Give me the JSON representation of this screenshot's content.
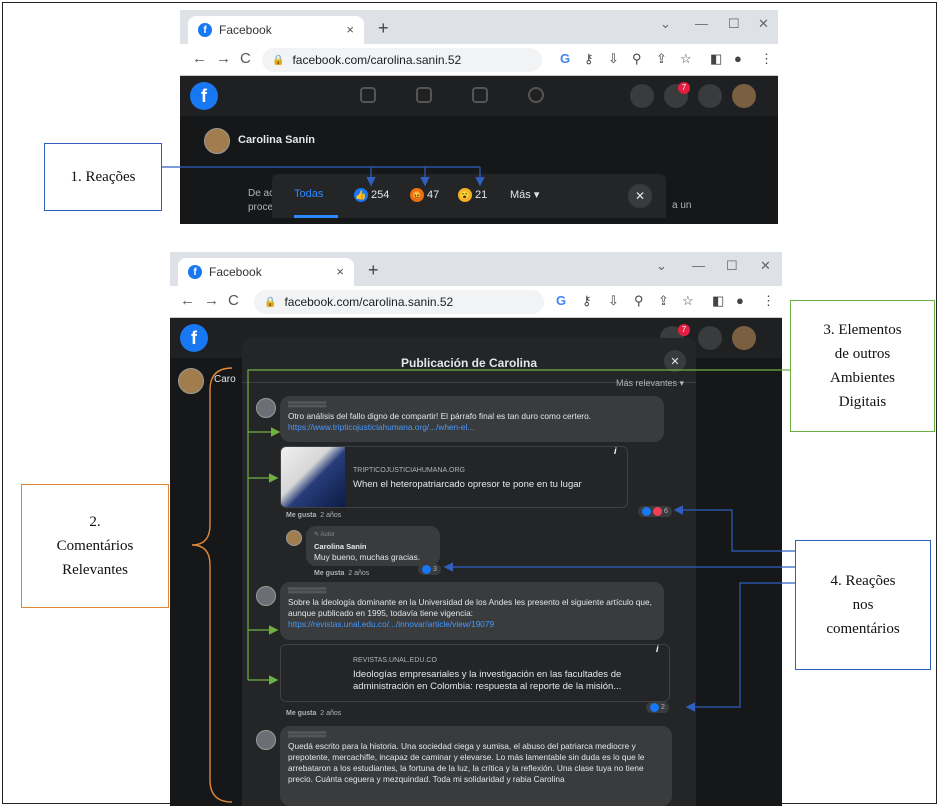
{
  "browser": {
    "tab_title": "Facebook",
    "url": "facebook.com/carolina.sanin.52",
    "new_tab_icon": "+",
    "close_icon": "×"
  },
  "screen1": {
    "profile_name": "Carolina Sanín",
    "snippet_left": "De acu",
    "snippet_left2": "proced",
    "snippet_right": "a un",
    "reactions_bar": {
      "all_label": "Todas",
      "like_count": "254",
      "angry_count": "47",
      "wow_count": "21",
      "more_label": "Más ▾"
    }
  },
  "screen2": {
    "modal_title": "Publicación de Carolina",
    "sort_label": "Más relevantes ▾",
    "side_name": "Caro",
    "comments": [
      {
        "text": "Otro análisis del fallo digno de compartir! El párrafo final es tan duro como certero.",
        "link": "https://www.tripticojusticiahumana.org/.../when-el...",
        "card_domain": "TRIPTICOJUSTICIAHUMANA.ORG",
        "card_title": "When el heteropatriarcado opresor te pone en tu lugar",
        "meta_like": "Me gusta",
        "meta_time": "2 años",
        "reaction_count": "6"
      },
      {
        "author_badge": "Autor",
        "author": "Carolina Sanín",
        "text": "Muy bueno, muchas gracias.",
        "meta_like": "Me gusta",
        "meta_time": "2 años",
        "reaction_count": "3"
      },
      {
        "text": "Sobre la ideología dominante en la Universidad de los Andes les presento el siguiente artículo que, aunque publicado en 1995, todavía tiene vigencia:",
        "link": "https://revistas.unal.edu.co/.../innovar/article/view/19079",
        "card_domain": "REVISTAS.UNAL.EDU.CO",
        "card_title": "Ideologías empresariales y la investigación en las facultades de administración en Colombia: respuesta al reporte de la misión...",
        "meta_like": "Me gusta",
        "meta_time": "2 años",
        "reaction_count": "2"
      },
      {
        "text": "Quedá escrito para la historia. Una sociedad ciega y sumisa, el abuso del patriarca mediocre y prepotente, mercachifle, incapaz de caminar y elevarse. Lo más lamentable sin duda es lo que le arrebataron a los estudiantes, la fortuna de la luz, la crítica y la reflexión. Una clase tuya no tiene precio. Cuánta ceguera y mezquindad. Toda mi solidaridad y rabia Carolina"
      }
    ]
  },
  "annotations": {
    "reacoes": "1. Reações",
    "comentarios": [
      "2.",
      "Comentários",
      "Relevantes"
    ],
    "elementos": [
      "3. Elementos",
      "de outros",
      "Ambientes",
      "Digitais"
    ],
    "reacoes_comentarios": [
      "4. Reações",
      "nos",
      "comentários"
    ]
  },
  "colors": {
    "annotation_blue": "#2f5fbf",
    "annotation_orange": "#e0883a",
    "annotation_green": "#6fb043",
    "facebook_blue": "#1877f2"
  }
}
